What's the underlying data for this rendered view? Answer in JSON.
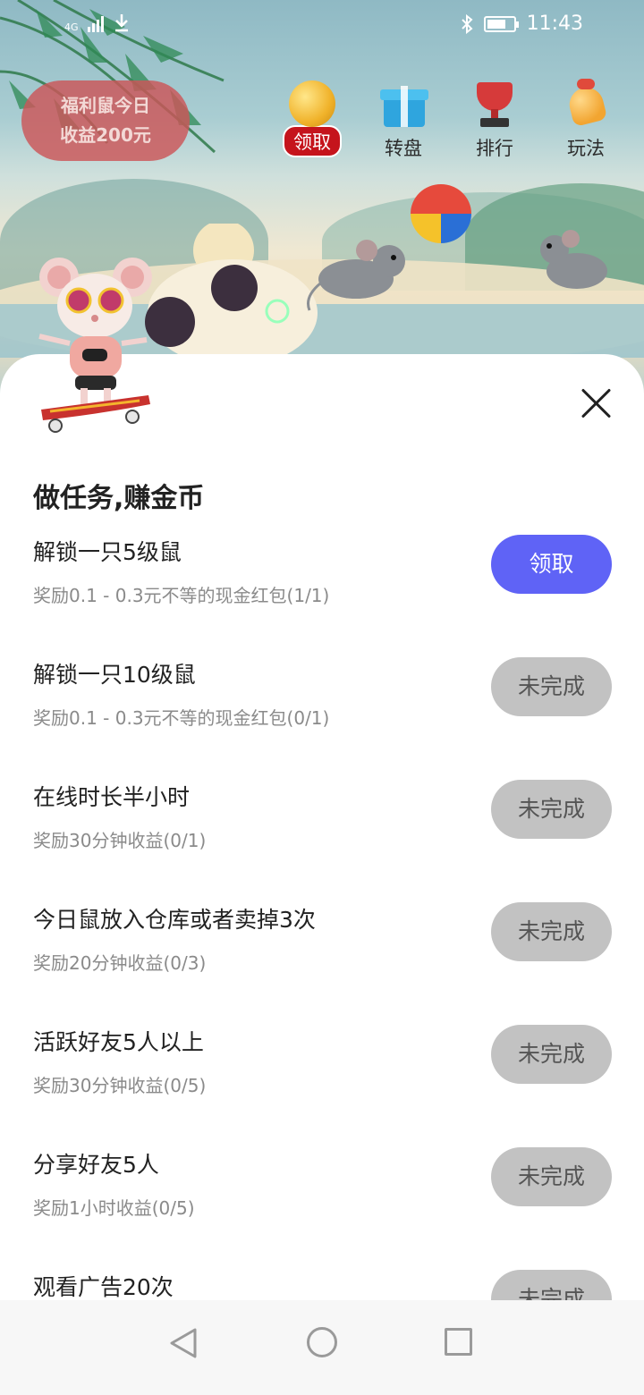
{
  "status_bar": {
    "network": "4G",
    "time": "11:43",
    "icons": [
      "signal-icon",
      "download-icon",
      "bluetooth-icon",
      "battery-icon"
    ]
  },
  "banner": {
    "line1": "福利鼠今日",
    "line2": "收益200元"
  },
  "top_nav": [
    {
      "label": "领取",
      "icon": "coin-icon"
    },
    {
      "label": "转盘",
      "icon": "gift-icon"
    },
    {
      "label": "排行",
      "icon": "trophy-icon"
    },
    {
      "label": "玩法",
      "icon": "bell-icon"
    }
  ],
  "sheet": {
    "title": "做任务,赚金币",
    "tasks": [
      {
        "name": "解锁一只5级鼠",
        "reward": "奖励0.1 - 0.3元不等的现金红包(1/1)",
        "button": "领取",
        "state": "claimable"
      },
      {
        "name": "解锁一只10级鼠",
        "reward": "奖励0.1 - 0.3元不等的现金红包(0/1)",
        "button": "未完成",
        "state": "incomplete"
      },
      {
        "name": "在线时长半小时",
        "reward": "奖励30分钟收益(0/1)",
        "button": "未完成",
        "state": "incomplete"
      },
      {
        "name": "今日鼠放入仓库或者卖掉3次",
        "reward": "奖励20分钟收益(0/3)",
        "button": "未完成",
        "state": "incomplete"
      },
      {
        "name": "活跃好友5人以上",
        "reward": "奖励30分钟收益(0/5)",
        "button": "未完成",
        "state": "incomplete"
      },
      {
        "name": "分享好友5人",
        "reward": "奖励1小时收益(0/5)",
        "button": "未完成",
        "state": "incomplete"
      },
      {
        "name": "观看广告20次",
        "reward": "",
        "button": "未完成",
        "state": "incomplete"
      }
    ]
  },
  "colors": {
    "claim_button": "#5f63f6",
    "pending_button": "#c2c2c2",
    "banner": "#cc5558",
    "pill_red": "#c5141c"
  }
}
